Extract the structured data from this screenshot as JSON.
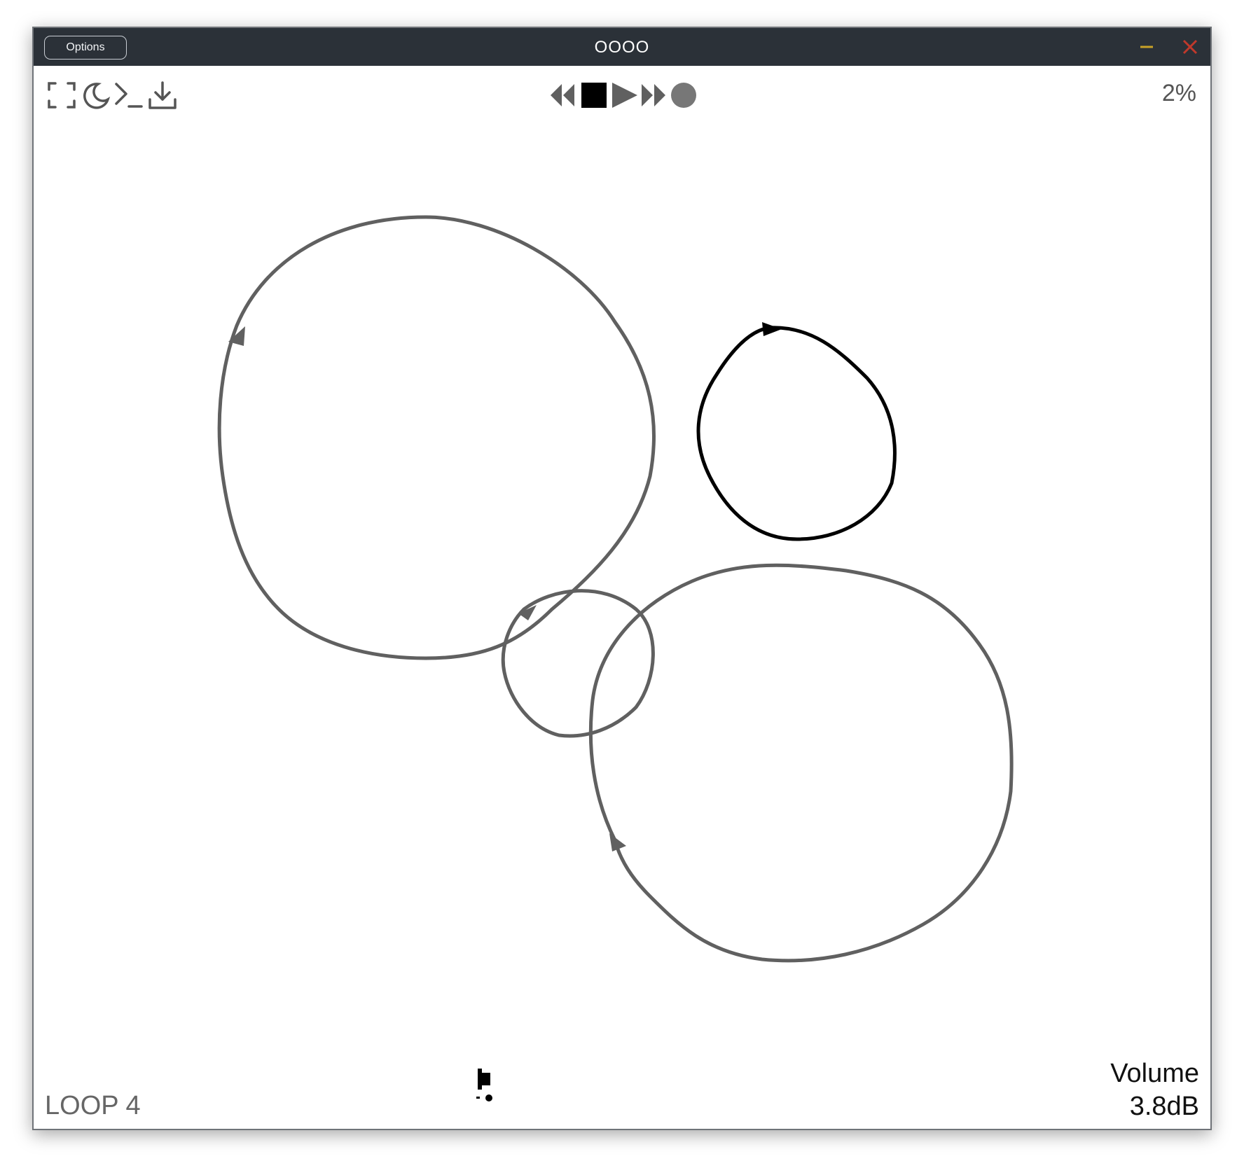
{
  "window": {
    "title": "OOOO",
    "options_label": "Options"
  },
  "toolbar": {
    "icons": [
      "fullscreen-icon",
      "moon-icon",
      "terminal-icon",
      "download-icon"
    ]
  },
  "transport": {
    "buttons": [
      "rewind-icon",
      "stop-icon",
      "play-icon",
      "fast-forward-icon",
      "record-icon"
    ]
  },
  "status": {
    "zoom": "2%",
    "loop": "LOOP 4",
    "volume_label": "Volume",
    "volume_value": "3.8dB"
  },
  "colors": {
    "titlebar": "#2b3138",
    "minimize": "#c9a227",
    "close": "#c0392b",
    "loop_stroke": "#606060",
    "active_loop_stroke": "#000000"
  }
}
